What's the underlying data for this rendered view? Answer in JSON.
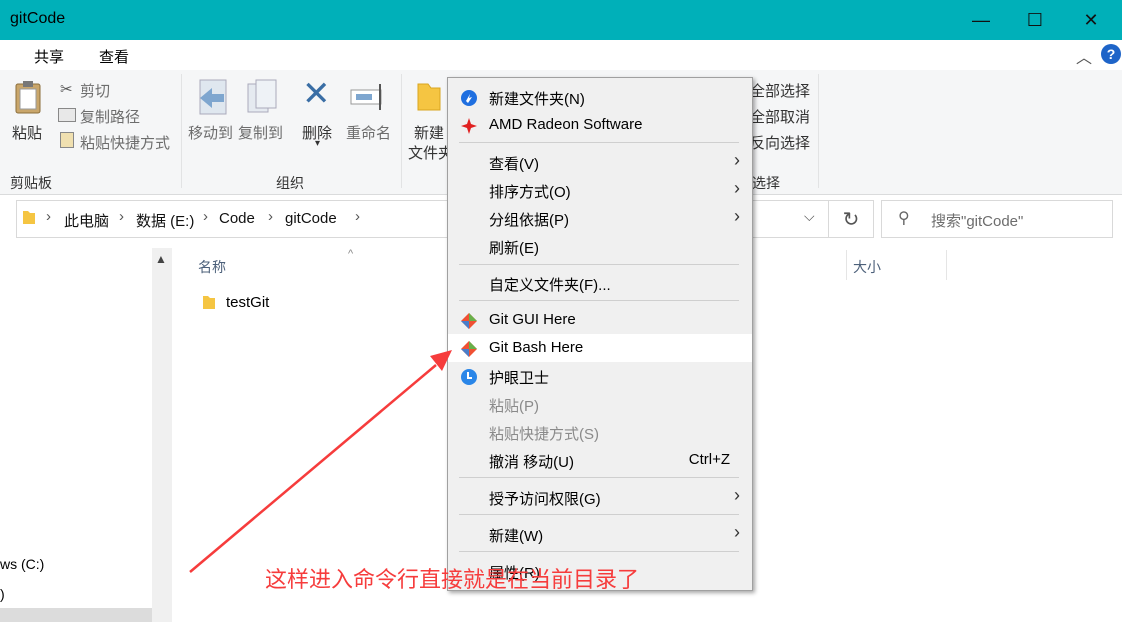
{
  "window": {
    "title": "gitCode",
    "controls": {
      "minimize": "—",
      "maximize": "☐",
      "close": "✕"
    }
  },
  "ribbon_tabs": [
    "共享",
    "查看"
  ],
  "ribbon": {
    "clipboard": {
      "paste": "粘贴",
      "cut": "剪切",
      "copy_path": "复制路径",
      "paste_shortcut": "粘贴快捷方式",
      "group_label": "剪贴板"
    },
    "organize": {
      "move_to": "移动到",
      "copy_to": "复制到",
      "delete": "删除",
      "rename": "重命名",
      "group_label": "组织"
    },
    "new": {
      "new_folder_line1": "新建",
      "new_folder_line2": "文件夹"
    },
    "select": {
      "select_all": "全部选择",
      "select_none": "全部取消",
      "invert": "反向选择",
      "group_label": "选择"
    }
  },
  "address": {
    "crumbs": [
      "此电脑",
      "数据 (E:)",
      "Code",
      "gitCode"
    ],
    "search_placeholder": "搜索\"gitCode\""
  },
  "nav_pane": {
    "items": [
      "ws (C:)",
      ")"
    ]
  },
  "file_list": {
    "columns": {
      "name": "名称",
      "size": "大小"
    },
    "items": [
      {
        "name": "testGit"
      }
    ]
  },
  "context_menu": {
    "items": [
      {
        "label": "新建文件夹(N)",
        "icon": "baidu-netdisk-icon"
      },
      {
        "label": "AMD Radeon Software",
        "icon": "amd-radeon-icon"
      },
      {
        "label": "查看(V)",
        "submenu": true
      },
      {
        "label": "排序方式(O)",
        "submenu": true
      },
      {
        "label": "分组依据(P)",
        "submenu": true
      },
      {
        "label": "刷新(E)"
      },
      {
        "label": "自定义文件夹(F)..."
      },
      {
        "label": "Git GUI Here",
        "icon": "git-icon"
      },
      {
        "label": "Git Bash Here",
        "icon": "git-icon",
        "highlighted": true
      },
      {
        "label": "护眼卫士",
        "icon": "eye-guard-icon"
      },
      {
        "label": "粘贴(P)",
        "disabled": true
      },
      {
        "label": "粘贴快捷方式(S)",
        "disabled": true
      },
      {
        "label": "撤消 移动(U)",
        "shortcut": "Ctrl+Z"
      },
      {
        "label": "授予访问权限(G)",
        "submenu": true
      },
      {
        "label": "新建(W)",
        "submenu": true
      },
      {
        "label": "属性(R)"
      }
    ]
  },
  "annotation": {
    "text": "这样进入命令行直接就是在当前目录了",
    "color": "#f63c3c"
  },
  "colors": {
    "titlebar": "#00b0b9",
    "menu_bg": "#f0f0f0",
    "accent_arrow": "#f63c3c"
  }
}
